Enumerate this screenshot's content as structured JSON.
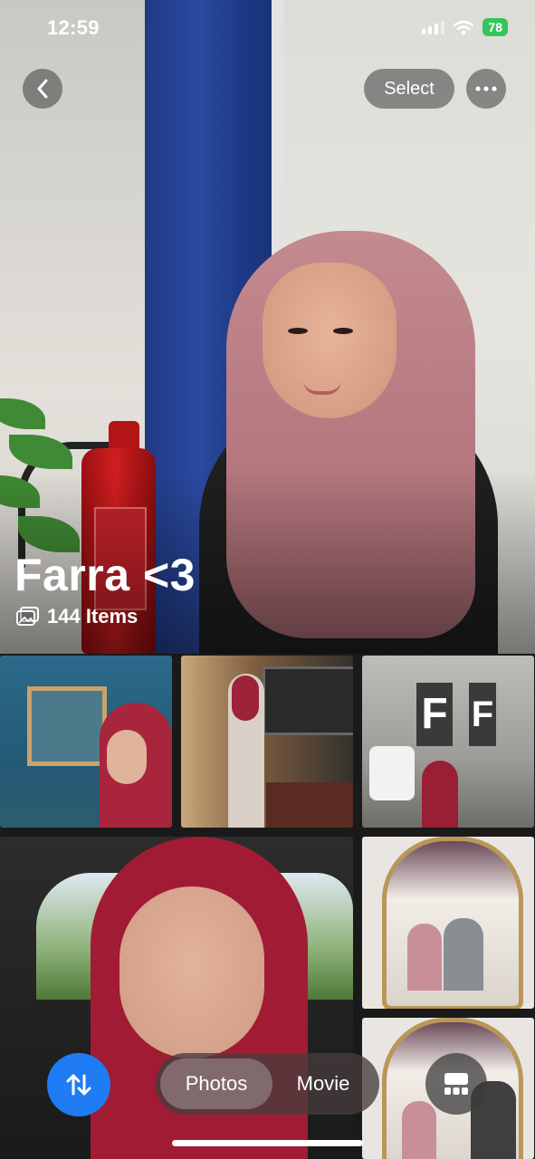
{
  "status_bar": {
    "time": "12:59",
    "battery": "78",
    "icons": [
      "signal-icon",
      "wifi-icon",
      "battery-icon"
    ]
  },
  "top_bar": {
    "back_icon": "chevron-left-icon",
    "select_label": "Select",
    "more_icon": "ellipsis-icon"
  },
  "album": {
    "title": "Farra <3",
    "count_label": "144 Items",
    "count_icon": "photo-stack-icon"
  },
  "grid": {
    "tiles": [
      "photo-1",
      "photo-2",
      "photo-3",
      "photo-4",
      "photo-5",
      "photo-6"
    ]
  },
  "bottom_bar": {
    "sort_icon": "sort-arrows-icon",
    "segments": [
      {
        "label": "Photos",
        "selected": true
      },
      {
        "label": "Movie",
        "selected": false
      }
    ],
    "layout_icon": "grid-layout-icon"
  },
  "colors": {
    "accent": "#1f7cf5",
    "battery": "#33c759"
  }
}
